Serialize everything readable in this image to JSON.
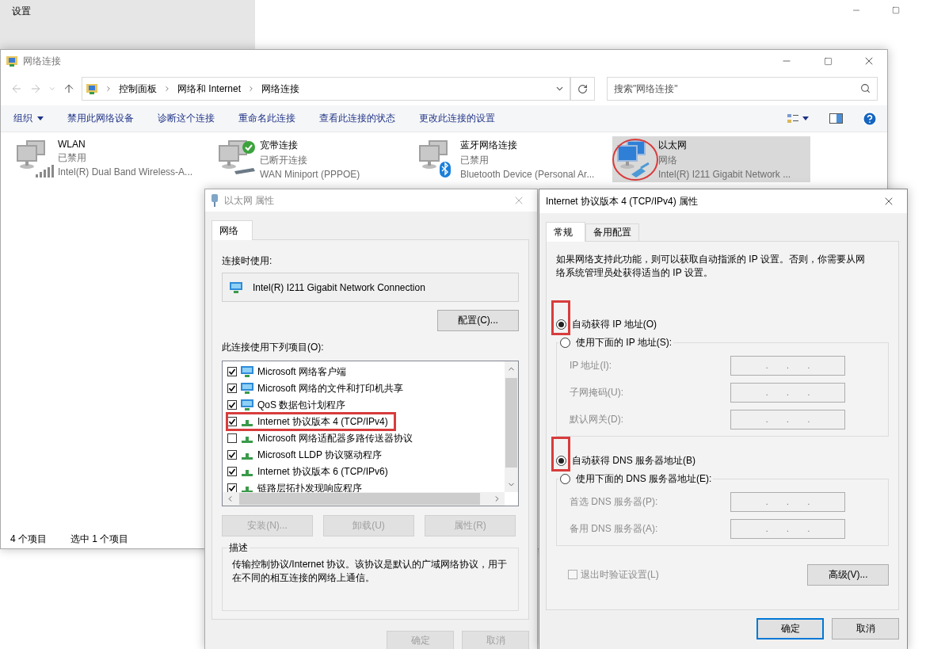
{
  "settings_window": {
    "title": "设置"
  },
  "network_window": {
    "title": "网络连接",
    "breadcrumb": [
      "控制面板",
      "网络和 Internet",
      "网络连接"
    ],
    "search": {
      "placeholder": "搜索\"网络连接\""
    },
    "toolbar": [
      {
        "label": "组织",
        "kind": "menu"
      },
      {
        "label": "禁用此网络设备",
        "kind": "command"
      },
      {
        "label": "诊断这个连接",
        "kind": "command"
      },
      {
        "label": "重命名此连接",
        "kind": "command"
      },
      {
        "label": "查看此连接的状态",
        "kind": "command"
      },
      {
        "label": "更改此连接的设置",
        "kind": "command"
      }
    ],
    "connections": [
      {
        "name": "WLAN",
        "status": "已禁用",
        "device": "Intel(R) Dual Band Wireless-A...",
        "kind": "wifi",
        "selected": false,
        "circled": false
      },
      {
        "name": "宽带连接",
        "status": "已断开连接",
        "device": "WAN Miniport (PPPOE)",
        "kind": "broadband",
        "selected": false,
        "circled": false
      },
      {
        "name": "蓝牙网络连接",
        "status": "已禁用",
        "device": "Bluetooth Device (Personal Ar...",
        "kind": "bluetooth",
        "selected": false,
        "circled": false
      },
      {
        "name": "以太网",
        "status": "网络",
        "device": "Intel(R) I211 Gigabit Network ...",
        "kind": "ethernet",
        "selected": true,
        "circled": true
      }
    ],
    "status_bar": [
      "4 个项目",
      "选中 1 个项目"
    ]
  },
  "ethernet_properties": {
    "title": "以太网 属性",
    "tabs": [
      {
        "label": "网络",
        "selected": true
      }
    ],
    "connect_using_label": "连接时使用:",
    "adapter": "Intel(R) I211 Gigabit Network Connection",
    "configure_button": "配置(C)...",
    "items_label": "此连接使用下列项目(O):",
    "items": [
      {
        "label": "Microsoft 网络客户端",
        "checked": true,
        "kind": "client",
        "framed": false
      },
      {
        "label": "Microsoft 网络的文件和打印机共享",
        "checked": true,
        "kind": "client",
        "framed": false
      },
      {
        "label": "QoS 数据包计划程序",
        "checked": true,
        "kind": "client",
        "framed": false
      },
      {
        "label": "Internet 协议版本 4 (TCP/IPv4)",
        "checked": true,
        "kind": "protocol",
        "framed": true
      },
      {
        "label": "Microsoft 网络适配器多路传送器协议",
        "checked": false,
        "kind": "protocol",
        "framed": false
      },
      {
        "label": "Microsoft LLDP 协议驱动程序",
        "checked": true,
        "kind": "protocol",
        "framed": false
      },
      {
        "label": "Internet 协议版本 6 (TCP/IPv6)",
        "checked": true,
        "kind": "protocol",
        "framed": false
      },
      {
        "label": "链路层拓扑发现响应程序",
        "checked": true,
        "kind": "protocol",
        "framed": false
      }
    ],
    "item_buttons": [
      {
        "label": "安装(N)...",
        "disabled": true
      },
      {
        "label": "卸载(U)",
        "disabled": true
      },
      {
        "label": "属性(R)",
        "disabled": true
      }
    ],
    "description_title": "描述",
    "description": "传输控制协议/Internet 协议。该协议是默认的广域网络协议，用于在不同的相互连接的网络上通信。",
    "dialog_buttons": [
      {
        "label": "确定",
        "disabled": true
      },
      {
        "label": "取消",
        "disabled": true
      }
    ]
  },
  "ipv4_properties": {
    "title": "Internet 协议版本 4 (TCP/IPv4) 属性",
    "tabs": [
      {
        "label": "常规",
        "selected": true
      },
      {
        "label": "备用配置",
        "selected": false
      }
    ],
    "intro": "如果网络支持此功能，则可以获取自动指派的 IP 设置。否则，你需要从网络系统管理员处获得适当的 IP 设置。",
    "ip_mode": [
      {
        "label": "自动获得 IP 地址(O)",
        "selected": true,
        "framed": true
      },
      {
        "label": "使用下面的 IP 地址(S):",
        "selected": false,
        "framed": false
      }
    ],
    "ip_fields": [
      {
        "label": "IP 地址(I):",
        "disabled": true
      },
      {
        "label": "子网掩码(U):",
        "disabled": true
      },
      {
        "label": "默认网关(D):",
        "disabled": true
      }
    ],
    "dns_mode": [
      {
        "label": "自动获得 DNS 服务器地址(B)",
        "selected": true,
        "framed": true
      },
      {
        "label": "使用下面的 DNS 服务器地址(E):",
        "selected": false,
        "framed": false
      }
    ],
    "dns_fields": [
      {
        "label": "首选 DNS 服务器(P):",
        "disabled": true
      },
      {
        "label": "备用 DNS 服务器(A):",
        "disabled": true
      }
    ],
    "octet_separator": ".",
    "validate_checkbox": {
      "label": "退出时验证设置(L)",
      "checked": false,
      "disabled": true
    },
    "advanced_button": "高级(V)...",
    "dialog_buttons": [
      {
        "label": "确定",
        "default": true
      },
      {
        "label": "取消",
        "default": false
      }
    ]
  }
}
